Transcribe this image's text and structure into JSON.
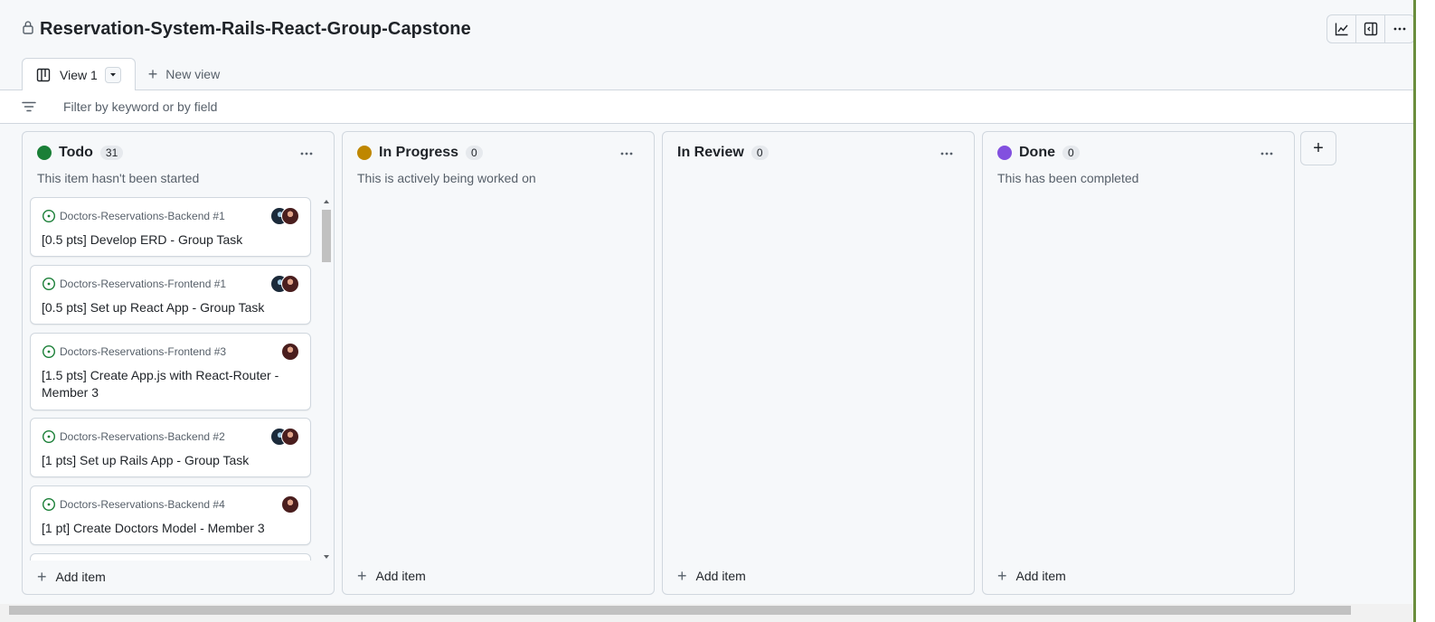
{
  "header": {
    "title": "Reservation-System-Rails-React-Group-Capstone"
  },
  "tabs": {
    "active_label": "View 1",
    "new_view_label": "New view"
  },
  "filter": {
    "placeholder": "Filter by keyword or by field"
  },
  "columns": [
    {
      "name": "Todo",
      "count": "31",
      "color": "#1a7f37",
      "description": "This item hasn't been started",
      "add_label": "Add item",
      "cards": [
        {
          "repo": "Doctors-Reservations-Backend #1",
          "title": "[0.5 pts] Develop ERD - Group Task"
        },
        {
          "repo": "Doctors-Reservations-Frontend #1",
          "title": "[0.5 pts] Set up React App - Group Task"
        },
        {
          "repo": "Doctors-Reservations-Frontend #3",
          "title": "[1.5 pts] Create App.js with React-Router - Member 3"
        },
        {
          "repo": "Doctors-Reservations-Backend #2",
          "title": "[1 pts] Set up Rails App - Group Task"
        },
        {
          "repo": "Doctors-Reservations-Backend #4",
          "title": "[1 pt] Create Doctors Model - Member 3"
        }
      ]
    },
    {
      "name": "In Progress",
      "count": "0",
      "color": "#bf8700",
      "description": "This is actively being worked on",
      "add_label": "Add item"
    },
    {
      "name": "In Review",
      "count": "0",
      "description": "",
      "add_label": "Add item"
    },
    {
      "name": "Done",
      "count": "0",
      "color": "#8250df",
      "description": "This has been completed",
      "add_label": "Add item"
    }
  ],
  "icons": {
    "lock": "lock-icon",
    "insights": "graph-icon",
    "side_panel": "sidebar-icon",
    "more": "kebab-icon",
    "board": "board-icon",
    "filter": "filter-icon",
    "issue_open": "issue-opened-icon"
  }
}
